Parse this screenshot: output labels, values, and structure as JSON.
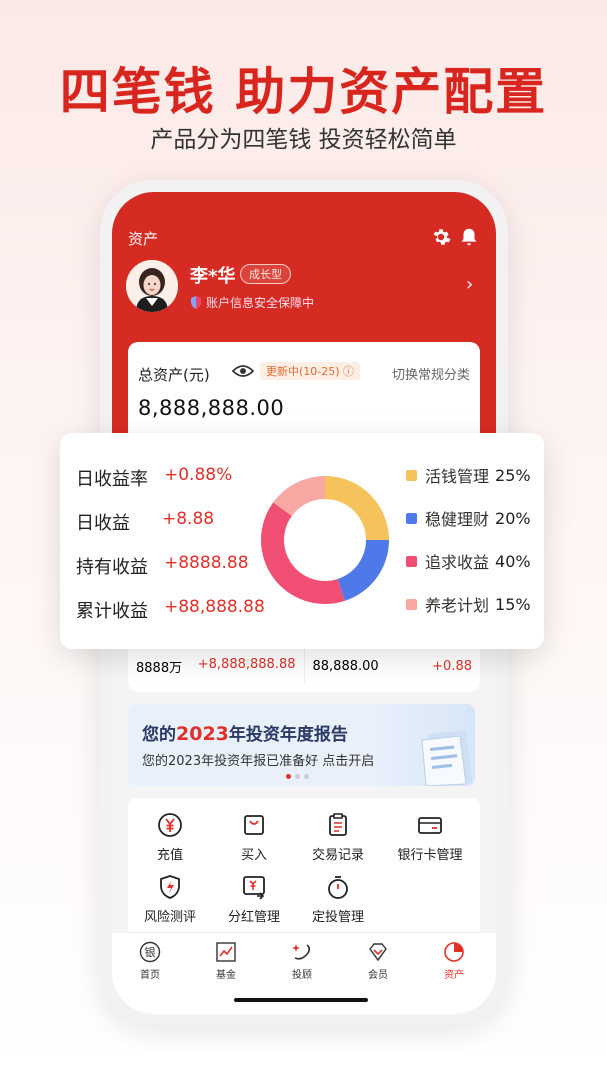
{
  "promo": {
    "title": "四笔钱 助力资产配置",
    "subtitle": "产品分为四笔钱 投资轻松简单"
  },
  "header": {
    "title": "资产",
    "user_name": "李*华",
    "user_type": "成长型",
    "security_text": "账户信息安全保障中"
  },
  "asset_card": {
    "label": "总资产(元)",
    "update_badge": "更新中(10-25)",
    "switch_label": "切换常规分类",
    "total": "8,888,888.00"
  },
  "metrics": [
    {
      "label": "日收益率",
      "value": "+0.88%"
    },
    {
      "label": "日收益",
      "value": "+8.88"
    },
    {
      "label": "持有收益",
      "value": "+8888.88"
    },
    {
      "label": "累计收益",
      "value": "+88,888.88"
    }
  ],
  "allocation": [
    {
      "name": "活钱管理",
      "pct": "25%",
      "value": 25,
      "color": "#f5c25b"
    },
    {
      "name": "稳健理财",
      "pct": "20%",
      "value": 20,
      "color": "#4f78e8"
    },
    {
      "name": "追求收益",
      "pct": "40%",
      "value": 40,
      "color": "#f04e73"
    },
    {
      "name": "养老计划",
      "pct": "15%",
      "value": 15,
      "color": "#f7a8a2"
    }
  ],
  "row_under": {
    "left_a": "8888万",
    "left_b": "+8,888,888.88",
    "right_a": "88,888.00",
    "right_b": "+0.88"
  },
  "banner": {
    "title_pre": "您的",
    "title_year": "2023",
    "title_post": "年投资年度报告",
    "subtitle": "您的2023年投资年报已准备好 点击开启"
  },
  "actions": [
    {
      "label": "充值",
      "icon": "yuan-circle-icon"
    },
    {
      "label": "买入",
      "icon": "bag-icon"
    },
    {
      "label": "交易记录",
      "icon": "clipboard-icon"
    },
    {
      "label": "银行卡管理",
      "icon": "card-icon"
    },
    {
      "label": "风险测评",
      "icon": "shield-bolt-icon"
    },
    {
      "label": "分红管理",
      "icon": "dividend-icon"
    },
    {
      "label": "定投管理",
      "icon": "stopwatch-icon"
    }
  ],
  "tabs": [
    {
      "label": "首页",
      "icon": "bank-icon"
    },
    {
      "label": "基金",
      "icon": "chart-icon"
    },
    {
      "label": "投顾",
      "icon": "advisor-icon"
    },
    {
      "label": "会员",
      "icon": "diamond-icon"
    },
    {
      "label": "资产",
      "icon": "pie-icon"
    }
  ],
  "colors": {
    "brand": "#d52b22",
    "up": "#e0302a"
  }
}
